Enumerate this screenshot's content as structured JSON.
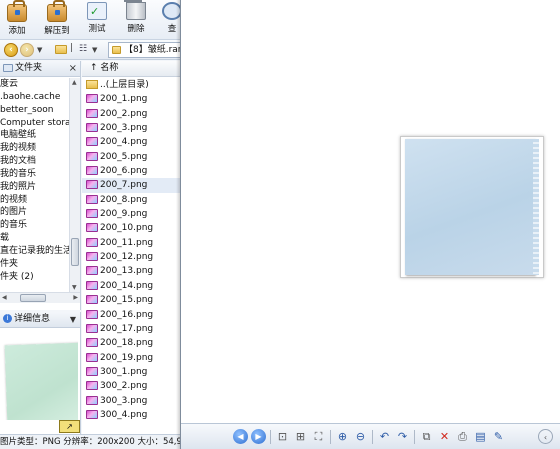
{
  "toolbar": {
    "buttons": [
      {
        "label": "添加",
        "icon": "add-archive-icon"
      },
      {
        "label": "解压到",
        "icon": "extract-icon"
      },
      {
        "label": "测试",
        "icon": "test-icon"
      },
      {
        "label": "删除",
        "icon": "delete-icon"
      },
      {
        "label": "查",
        "icon": "find-icon"
      }
    ]
  },
  "address": {
    "path": "【8】皱纸.rar\\"
  },
  "tree": {
    "title": "文件夹",
    "items": [
      "度云",
      ".baohe.cache",
      "better_soon",
      "Computer storag",
      "电脑壁纸",
      "我的视频",
      "我的文档",
      "我的音乐",
      "我的照片",
      "的视频",
      "的图片",
      "的音乐",
      "载",
      "直在记录我的生活",
      "件夹",
      "件夹 (2)"
    ]
  },
  "details": {
    "title": "详细信息"
  },
  "filelist": {
    "column_name": "名称",
    "parent_label": "..(上层目录)",
    "files": [
      "200_1.png",
      "200_2.png",
      "200_3.png",
      "200_4.png",
      "200_5.png",
      "200_6.png",
      "200_7.png",
      "200_8.png",
      "200_9.png",
      "200_10.png",
      "200_11.png",
      "200_12.png",
      "200_13.png",
      "200_14.png",
      "200_15.png",
      "200_16.png",
      "200_17.png",
      "200_18.png",
      "200_19.png",
      "300_1.png",
      "300_2.png",
      "300_3.png",
      "300_4.png"
    ],
    "selected": "200_7.png"
  },
  "status": {
    "text": "图片类型：PNG 分辨率：200x200 大小：54,966"
  },
  "viewer": {
    "buttons": [
      "previous-icon",
      "next-icon",
      "fit-window-icon",
      "actual-size-icon",
      "fullscreen-icon",
      "zoom-in-icon",
      "zoom-out-icon",
      "rotate-left-icon",
      "rotate-right-icon",
      "copy-icon",
      "delete-icon",
      "print-icon",
      "save-icon",
      "edit-icon",
      "collapse-icon"
    ]
  },
  "colors": {
    "accent": "#2e6fd1",
    "selected_row": "#e3ebf6",
    "paper_blue": "#c3d9ec",
    "paper_green": "#c6e6d4"
  }
}
